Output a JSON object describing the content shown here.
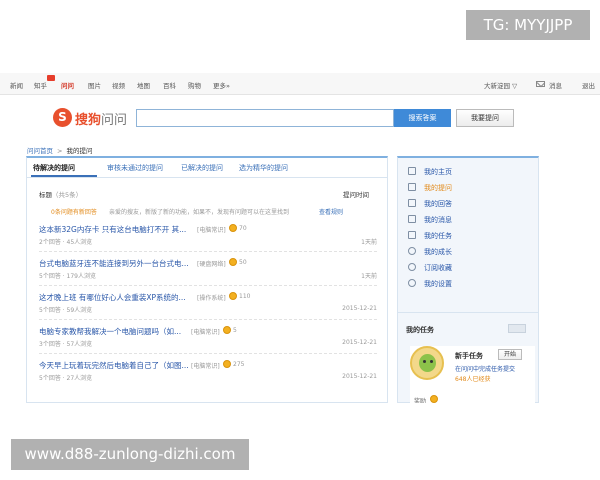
{
  "watermark_top": "TG: MYYJJPP",
  "watermark_bottom": "www.d88-zunlong-dizhi.com",
  "topnav": {
    "items": [
      "新闻",
      "知乎",
      "问问",
      "图片",
      "视频",
      "地图",
      "百科",
      "购物",
      "更多»"
    ],
    "right_user": "大新淀园 ▽",
    "mail": "消息",
    "logout": "退出"
  },
  "logo": {
    "mark": "S",
    "brand": "搜狗",
    "product": "问问"
  },
  "search": {
    "value": "",
    "button": "搜索答案",
    "ask_button": "我要提问"
  },
  "breadcrumb": {
    "home": "问问首页",
    "sep": ">",
    "current": "我的提问"
  },
  "tabs": [
    "待解决的提问",
    "审核未通过的提问",
    "已解决的提问",
    "选为精华的提问"
  ],
  "columns": {
    "title": "标题",
    "count": "（共5条）",
    "time": "提问时间"
  },
  "notice": {
    "orange": "0条问题有新回答",
    "gray": "亲爱的搜友，新版了新的功能，如果不，发现有问题可以在这里找到",
    "link": "查看规则"
  },
  "questions": [
    {
      "title": "这本新32G内存卡 只有这台电脑打不开 其...",
      "tag": "[电脑常识]",
      "reward": "70",
      "meta": "2个回答 · 45人浏览",
      "time": "1天前"
    },
    {
      "title": "台式电脑蓝牙连不能连接到另外一台台式电...",
      "tag": "[硬盘网络]",
      "reward": "50",
      "meta": "5个回答 · 179人浏览",
      "time": "1天前"
    },
    {
      "title": "这才晚上班 有哪位好心人会重装XP系统的...",
      "tag": "[操作系统]",
      "reward": "110",
      "meta": "5个回答 · 59人浏览",
      "time": "2015-12-21"
    },
    {
      "title": "电脑专家教帮我解决一个电脑问题吗（如...",
      "tag": "[电脑常识]",
      "reward": "5",
      "meta": "3个回答 · 57人浏览",
      "time": "2015-12-21"
    },
    {
      "title": "今天早上玩着玩完然后电脑着自己了（如图...",
      "tag": "[电脑常识]",
      "reward": "275",
      "meta": "5个回答 · 27人浏览",
      "time": "2015-12-21"
    }
  ],
  "sidebar": {
    "items": [
      "我的主页",
      "我的提问",
      "我的回答",
      "我的消息",
      "我的任务",
      "我的成长",
      "订阅收藏",
      "我的设置"
    ],
    "tasks_title": "我的任务",
    "task": {
      "name": "新手任务",
      "button": "开始",
      "desc": "在问问中完成任务提交",
      "count": "648人已经获",
      "reward": "奖励"
    }
  }
}
